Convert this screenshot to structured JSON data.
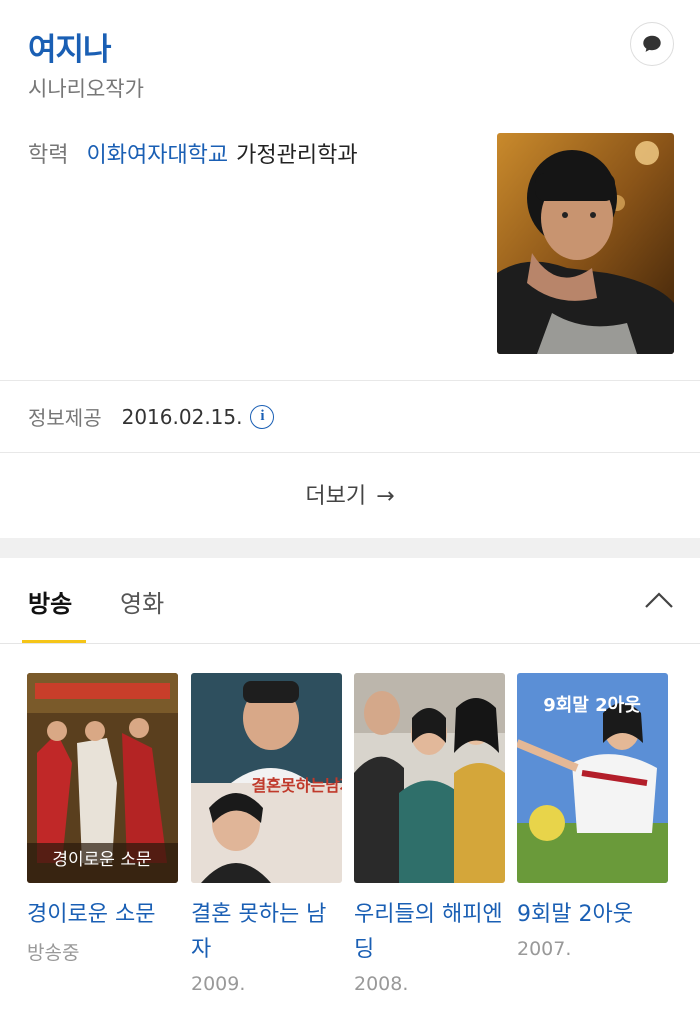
{
  "profile": {
    "name": "여지나",
    "role": "시나리오작가",
    "education_label": "학력",
    "education_school": "이화여자대학교",
    "education_dept": "가정관리학과",
    "info_label": "정보제공",
    "info_date": "2016.02.15.",
    "info_icon": "i",
    "more_label": "더보기",
    "more_arrow": "→"
  },
  "tabs": [
    {
      "label": "방송",
      "active": true
    },
    {
      "label": "영화",
      "active": false
    }
  ],
  "works": [
    {
      "title": "경이로운 소문",
      "year": "방송중",
      "poster_text": "경이로운 소문"
    },
    {
      "title": "결혼 못하는 남자",
      "year": "2009.",
      "poster_text": "결혼못하는남자"
    },
    {
      "title": "우리들의 해피엔딩",
      "year": "2008.",
      "poster_text": ""
    },
    {
      "title": "9회말 2아웃",
      "year": "2007.",
      "poster_text": "9회말 2아웃"
    }
  ],
  "icons": {
    "chat": "chat-bubble-icon",
    "info": "info-icon",
    "collapse": "chevron-up-icon",
    "arrow": "arrow-right-icon"
  },
  "colors": {
    "accent": "#1a5fb4",
    "tab_underline": "#f5c518"
  }
}
